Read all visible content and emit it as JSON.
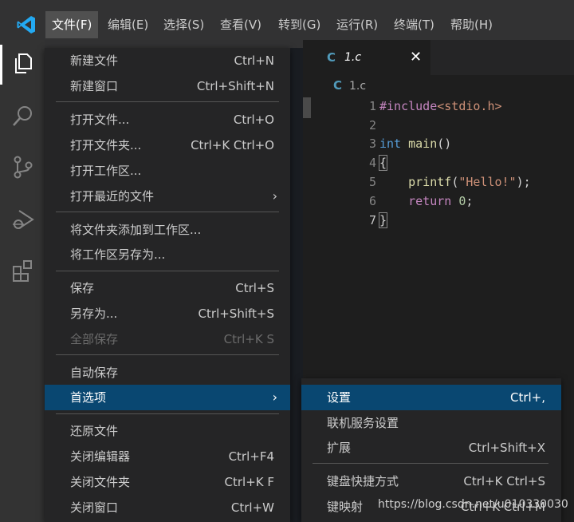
{
  "menubar": {
    "items": [
      "文件(F)",
      "编辑(E)",
      "选择(S)",
      "查看(V)",
      "转到(G)",
      "运行(R)",
      "终端(T)",
      "帮助(H)"
    ]
  },
  "colors": {
    "accent": "#094771",
    "logo": "#23a9f2",
    "background": "#1e1e1e"
  },
  "activity_bar": {
    "icons": [
      "files-icon",
      "search-icon",
      "source-control-icon",
      "run-debug-icon",
      "extensions-icon"
    ]
  },
  "editor": {
    "tab": {
      "icon": "C",
      "title": "1.c",
      "close": "✕"
    },
    "breadcrumb": {
      "icon": "C",
      "file": "1.c"
    },
    "code": {
      "line1": {
        "num": "1",
        "include": "#include",
        "header": "<stdio.h>"
      },
      "line2": {
        "num": "2"
      },
      "line3": {
        "num": "3",
        "type": "int",
        "func": "main",
        "rest": "()"
      },
      "line4": {
        "num": "4",
        "brace": "{"
      },
      "line5": {
        "num": "5",
        "indent": "    ",
        "func": "printf",
        "open": "(",
        "str": "\"Hello!\"",
        "close": ");"
      },
      "line6": {
        "num": "6",
        "indent": "    ",
        "kw": "return",
        "space": " ",
        "num_val": "0",
        "semi": ";"
      },
      "line7": {
        "num": "7",
        "brace": "}"
      }
    }
  },
  "file_menu": {
    "new_file": {
      "label": "新建文件",
      "shortcut": "Ctrl+N"
    },
    "new_window": {
      "label": "新建窗口",
      "shortcut": "Ctrl+Shift+N"
    },
    "open_file": {
      "label": "打开文件...",
      "shortcut": "Ctrl+O"
    },
    "open_folder": {
      "label": "打开文件夹...",
      "shortcut": "Ctrl+K Ctrl+O"
    },
    "open_workspace": {
      "label": "打开工作区..."
    },
    "open_recent": {
      "label": "打开最近的文件",
      "arrow": "›"
    },
    "add_folder": {
      "label": "将文件夹添加到工作区..."
    },
    "save_workspace_as": {
      "label": "将工作区另存为..."
    },
    "save": {
      "label": "保存",
      "shortcut": "Ctrl+S"
    },
    "save_as": {
      "label": "另存为...",
      "shortcut": "Ctrl+Shift+S"
    },
    "save_all": {
      "label": "全部保存",
      "shortcut": "Ctrl+K S"
    },
    "auto_save": {
      "label": "自动保存"
    },
    "preferences": {
      "label": "首选项",
      "arrow": "›"
    },
    "revert": {
      "label": "还原文件"
    },
    "close_editor": {
      "label": "关闭编辑器",
      "shortcut": "Ctrl+F4"
    },
    "close_folder": {
      "label": "关闭文件夹",
      "shortcut": "Ctrl+K F"
    },
    "close_window": {
      "label": "关闭窗口",
      "shortcut": "Ctrl+W"
    }
  },
  "preferences_menu": {
    "settings": {
      "label": "设置",
      "shortcut": "Ctrl+,"
    },
    "online_services": {
      "label": "联机服务设置"
    },
    "extensions": {
      "label": "扩展",
      "shortcut": "Ctrl+Shift+X"
    },
    "keyboard_shortcuts": {
      "label": "键盘快捷方式",
      "shortcut": "Ctrl+K Ctrl+S"
    },
    "keymaps": {
      "label": "键映射",
      "shortcut": "Ctrl+K Ctrl+M"
    }
  },
  "watermark": "https://blog.csdn.net/u010330030"
}
